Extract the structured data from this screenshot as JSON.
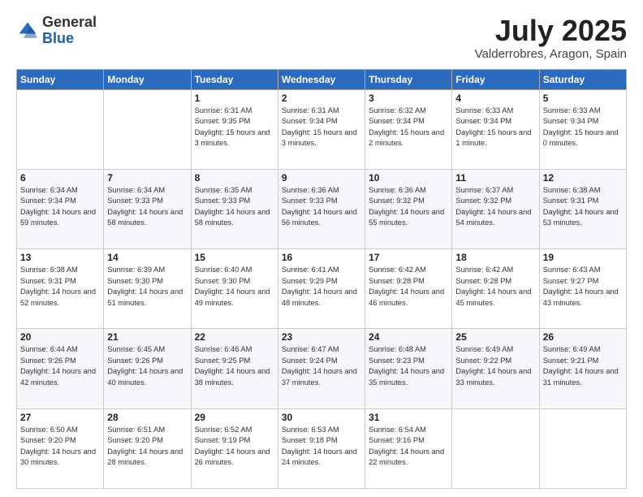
{
  "header": {
    "logo_general": "General",
    "logo_blue": "Blue",
    "month_year": "July 2025",
    "location": "Valderrobres, Aragon, Spain"
  },
  "weekdays": [
    "Sunday",
    "Monday",
    "Tuesday",
    "Wednesday",
    "Thursday",
    "Friday",
    "Saturday"
  ],
  "weeks": [
    [
      {
        "day": "",
        "sunrise": "",
        "sunset": "",
        "daylight": ""
      },
      {
        "day": "",
        "sunrise": "",
        "sunset": "",
        "daylight": ""
      },
      {
        "day": "1",
        "sunrise": "Sunrise: 6:31 AM",
        "sunset": "Sunset: 9:35 PM",
        "daylight": "Daylight: 15 hours and 3 minutes."
      },
      {
        "day": "2",
        "sunrise": "Sunrise: 6:31 AM",
        "sunset": "Sunset: 9:34 PM",
        "daylight": "Daylight: 15 hours and 3 minutes."
      },
      {
        "day": "3",
        "sunrise": "Sunrise: 6:32 AM",
        "sunset": "Sunset: 9:34 PM",
        "daylight": "Daylight: 15 hours and 2 minutes."
      },
      {
        "day": "4",
        "sunrise": "Sunrise: 6:33 AM",
        "sunset": "Sunset: 9:34 PM",
        "daylight": "Daylight: 15 hours and 1 minute."
      },
      {
        "day": "5",
        "sunrise": "Sunrise: 6:33 AM",
        "sunset": "Sunset: 9:34 PM",
        "daylight": "Daylight: 15 hours and 0 minutes."
      }
    ],
    [
      {
        "day": "6",
        "sunrise": "Sunrise: 6:34 AM",
        "sunset": "Sunset: 9:34 PM",
        "daylight": "Daylight: 14 hours and 59 minutes."
      },
      {
        "day": "7",
        "sunrise": "Sunrise: 6:34 AM",
        "sunset": "Sunset: 9:33 PM",
        "daylight": "Daylight: 14 hours and 58 minutes."
      },
      {
        "day": "8",
        "sunrise": "Sunrise: 6:35 AM",
        "sunset": "Sunset: 9:33 PM",
        "daylight": "Daylight: 14 hours and 58 minutes."
      },
      {
        "day": "9",
        "sunrise": "Sunrise: 6:36 AM",
        "sunset": "Sunset: 9:33 PM",
        "daylight": "Daylight: 14 hours and 56 minutes."
      },
      {
        "day": "10",
        "sunrise": "Sunrise: 6:36 AM",
        "sunset": "Sunset: 9:32 PM",
        "daylight": "Daylight: 14 hours and 55 minutes."
      },
      {
        "day": "11",
        "sunrise": "Sunrise: 6:37 AM",
        "sunset": "Sunset: 9:32 PM",
        "daylight": "Daylight: 14 hours and 54 minutes."
      },
      {
        "day": "12",
        "sunrise": "Sunrise: 6:38 AM",
        "sunset": "Sunset: 9:31 PM",
        "daylight": "Daylight: 14 hours and 53 minutes."
      }
    ],
    [
      {
        "day": "13",
        "sunrise": "Sunrise: 6:38 AM",
        "sunset": "Sunset: 9:31 PM",
        "daylight": "Daylight: 14 hours and 52 minutes."
      },
      {
        "day": "14",
        "sunrise": "Sunrise: 6:39 AM",
        "sunset": "Sunset: 9:30 PM",
        "daylight": "Daylight: 14 hours and 51 minutes."
      },
      {
        "day": "15",
        "sunrise": "Sunrise: 6:40 AM",
        "sunset": "Sunset: 9:30 PM",
        "daylight": "Daylight: 14 hours and 49 minutes."
      },
      {
        "day": "16",
        "sunrise": "Sunrise: 6:41 AM",
        "sunset": "Sunset: 9:29 PM",
        "daylight": "Daylight: 14 hours and 48 minutes."
      },
      {
        "day": "17",
        "sunrise": "Sunrise: 6:42 AM",
        "sunset": "Sunset: 9:28 PM",
        "daylight": "Daylight: 14 hours and 46 minutes."
      },
      {
        "day": "18",
        "sunrise": "Sunrise: 6:42 AM",
        "sunset": "Sunset: 9:28 PM",
        "daylight": "Daylight: 14 hours and 45 minutes."
      },
      {
        "day": "19",
        "sunrise": "Sunrise: 6:43 AM",
        "sunset": "Sunset: 9:27 PM",
        "daylight": "Daylight: 14 hours and 43 minutes."
      }
    ],
    [
      {
        "day": "20",
        "sunrise": "Sunrise: 6:44 AM",
        "sunset": "Sunset: 9:26 PM",
        "daylight": "Daylight: 14 hours and 42 minutes."
      },
      {
        "day": "21",
        "sunrise": "Sunrise: 6:45 AM",
        "sunset": "Sunset: 9:26 PM",
        "daylight": "Daylight: 14 hours and 40 minutes."
      },
      {
        "day": "22",
        "sunrise": "Sunrise: 6:46 AM",
        "sunset": "Sunset: 9:25 PM",
        "daylight": "Daylight: 14 hours and 38 minutes."
      },
      {
        "day": "23",
        "sunrise": "Sunrise: 6:47 AM",
        "sunset": "Sunset: 9:24 PM",
        "daylight": "Daylight: 14 hours and 37 minutes."
      },
      {
        "day": "24",
        "sunrise": "Sunrise: 6:48 AM",
        "sunset": "Sunset: 9:23 PM",
        "daylight": "Daylight: 14 hours and 35 minutes."
      },
      {
        "day": "25",
        "sunrise": "Sunrise: 6:49 AM",
        "sunset": "Sunset: 9:22 PM",
        "daylight": "Daylight: 14 hours and 33 minutes."
      },
      {
        "day": "26",
        "sunrise": "Sunrise: 6:49 AM",
        "sunset": "Sunset: 9:21 PM",
        "daylight": "Daylight: 14 hours and 31 minutes."
      }
    ],
    [
      {
        "day": "27",
        "sunrise": "Sunrise: 6:50 AM",
        "sunset": "Sunset: 9:20 PM",
        "daylight": "Daylight: 14 hours and 30 minutes."
      },
      {
        "day": "28",
        "sunrise": "Sunrise: 6:51 AM",
        "sunset": "Sunset: 9:20 PM",
        "daylight": "Daylight: 14 hours and 28 minutes."
      },
      {
        "day": "29",
        "sunrise": "Sunrise: 6:52 AM",
        "sunset": "Sunset: 9:19 PM",
        "daylight": "Daylight: 14 hours and 26 minutes."
      },
      {
        "day": "30",
        "sunrise": "Sunrise: 6:53 AM",
        "sunset": "Sunset: 9:18 PM",
        "daylight": "Daylight: 14 hours and 24 minutes."
      },
      {
        "day": "31",
        "sunrise": "Sunrise: 6:54 AM",
        "sunset": "Sunset: 9:16 PM",
        "daylight": "Daylight: 14 hours and 22 minutes."
      },
      {
        "day": "",
        "sunrise": "",
        "sunset": "",
        "daylight": ""
      },
      {
        "day": "",
        "sunrise": "",
        "sunset": "",
        "daylight": ""
      }
    ]
  ]
}
